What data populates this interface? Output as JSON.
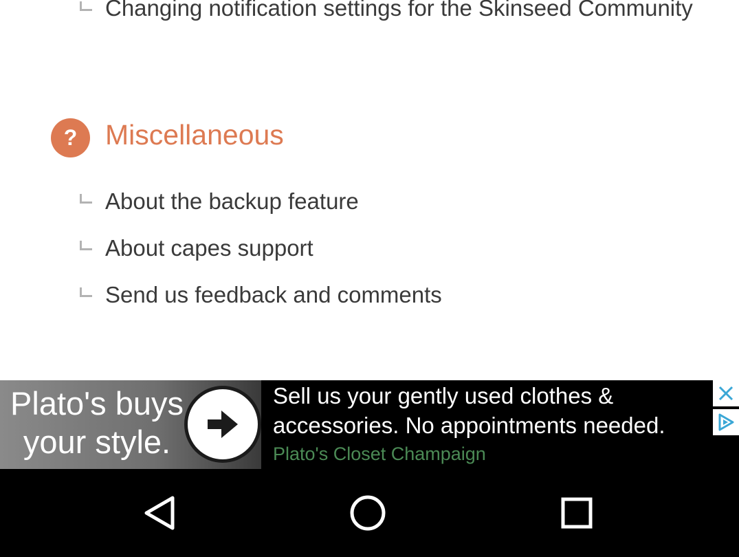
{
  "topics": {
    "previous_item": "Changing notification settings for the Skinseed Community",
    "section": {
      "icon": "question-mark-icon",
      "icon_glyph": "?",
      "title": "Miscellaneous",
      "accent_color": "#dd7a52",
      "items": [
        {
          "label": "About the backup feature"
        },
        {
          "label": "About capes support"
        },
        {
          "label": "Send us feedback and comments"
        }
      ]
    }
  },
  "ad": {
    "headline": "Plato's buys your style.",
    "body": "Sell us your gently used clothes & accessories. No appointments needed.",
    "advertiser": "Plato's Closet Champaign",
    "advertiser_color": "#4b8a55",
    "cta_icon": "arrow-right-icon",
    "close_icon": "close-icon",
    "adchoices_icon": "adchoices-icon"
  },
  "navbar": {
    "back_icon": "back-triangle-icon",
    "home_icon": "home-circle-icon",
    "recents_icon": "recents-square-icon"
  }
}
